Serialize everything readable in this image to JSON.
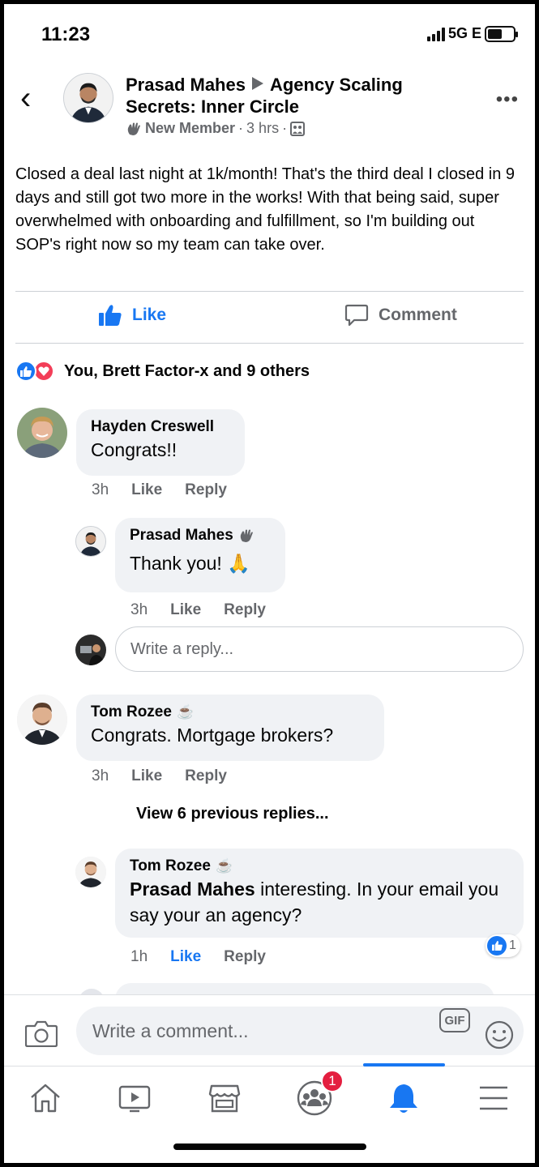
{
  "status_bar": {
    "time": "11:23",
    "network": "5G E"
  },
  "post": {
    "author": "Prasad Mahes",
    "group": "Agency Scaling Secrets: Inner Circle",
    "badge": "New Member",
    "time": "3 hrs",
    "body": "Closed a deal last night at 1k/month! That's the third deal I closed in 9 days and still got two more in the works! With that being said, super overwhelmed with onboarding and fulfillment, so I'm building out SOP's right now so my team can take over."
  },
  "actions": {
    "like": "Like",
    "comment": "Comment"
  },
  "reactions_summary": "You, Brett Factor-x and 9 others",
  "comments": [
    {
      "name": "Hayden Creswell",
      "text": "Congrats!!",
      "time": "3h",
      "like": "Like",
      "reply": "Reply"
    },
    {
      "name": "Prasad Mahes",
      "text": "Thank you! 🙏",
      "time": "3h",
      "like": "Like",
      "reply": "Reply"
    },
    {
      "name": "Tom Rozee",
      "text": "Congrats. Mortgage brokers?",
      "time": "3h",
      "like": "Like",
      "reply": "Reply"
    },
    {
      "name": "Tom Rozee",
      "mention": "Prasad Mahes",
      "text": "interesting. In your email you say your an agency?",
      "time": "1h",
      "like": "Like",
      "reply": "Reply",
      "like_count": "1"
    }
  ],
  "reply_placeholder": "Write a reply...",
  "view_previous": "View 6 previous replies...",
  "composer": {
    "placeholder": "Write a comment...",
    "gif": "GIF"
  },
  "nav": {
    "groups_badge": "1"
  },
  "colors": {
    "brand": "#1877f2",
    "bubble": "#f0f2f5",
    "secondary_text": "#65676b",
    "badge": "#e41e3f"
  }
}
